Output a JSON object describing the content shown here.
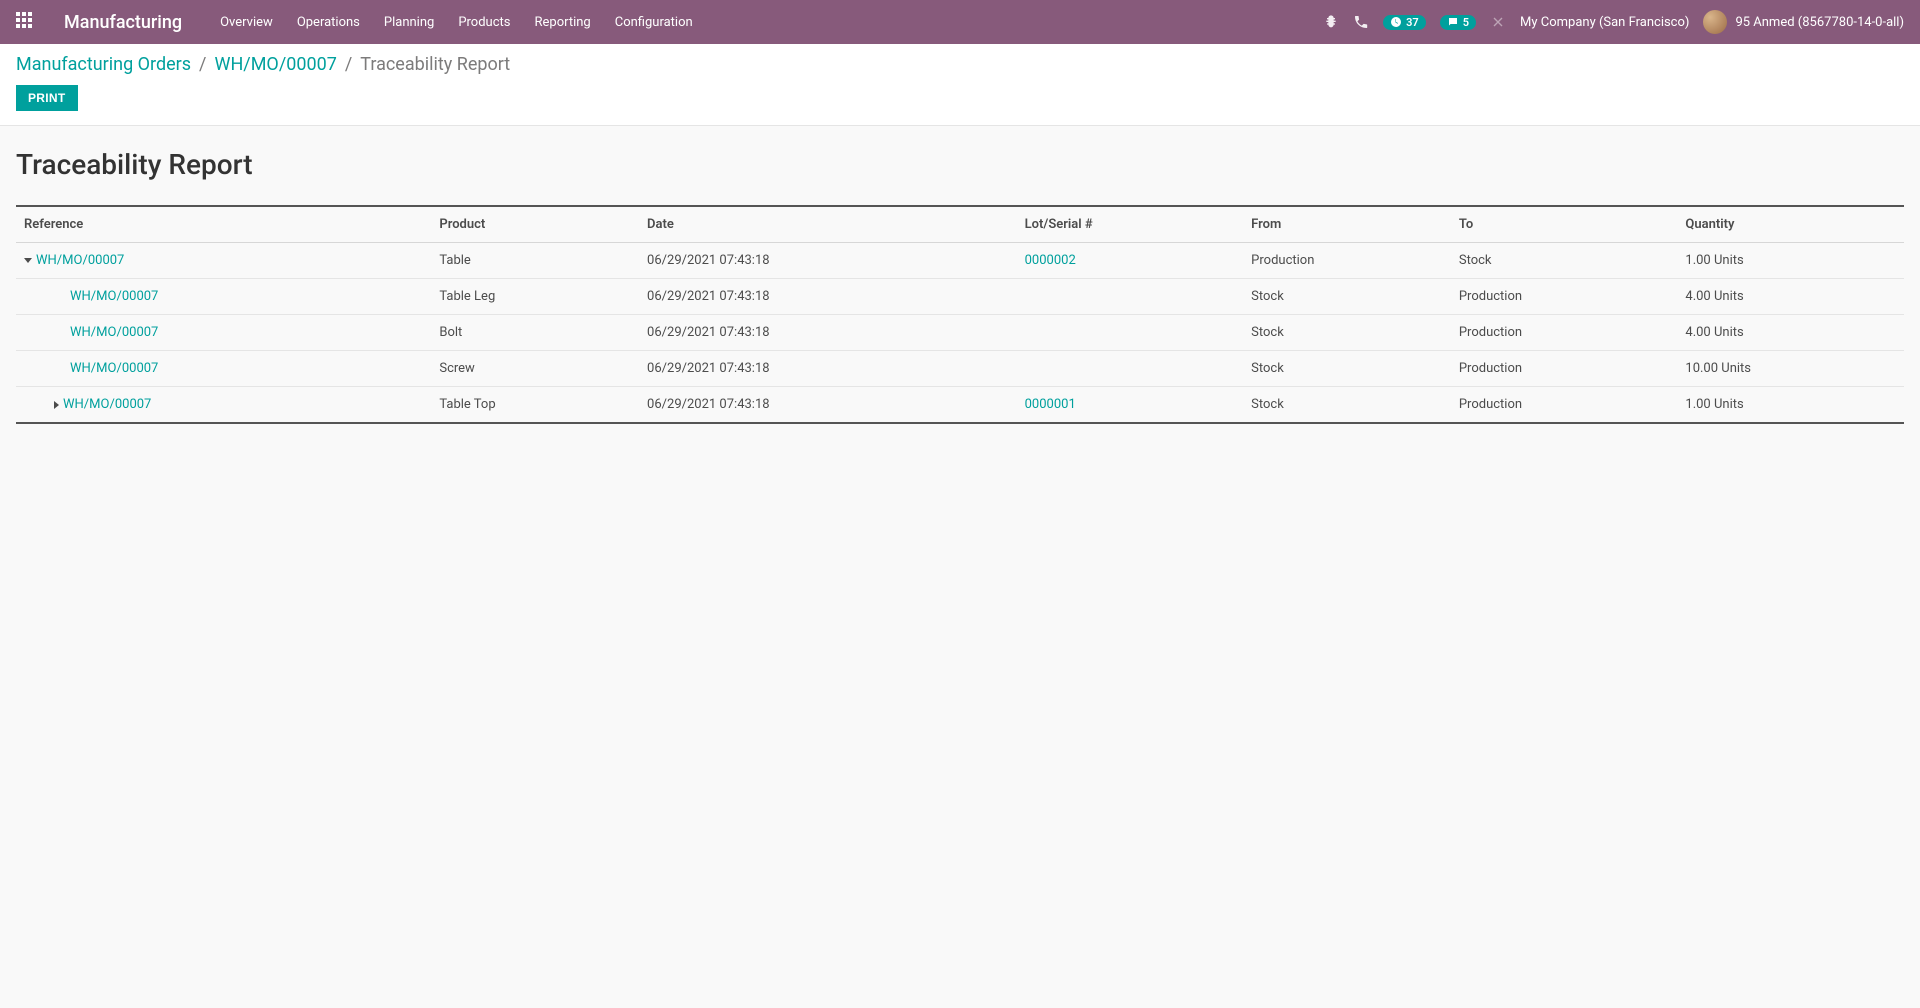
{
  "navbar": {
    "brand": "Manufacturing",
    "menu": [
      "Overview",
      "Operations",
      "Planning",
      "Products",
      "Reporting",
      "Configuration"
    ],
    "activities_badge": "37",
    "messages_badge": "5",
    "company": "My Company (San Francisco)",
    "user": "95 Anmed (8567780-14-0-all)"
  },
  "breadcrumbs": {
    "items": [
      "Manufacturing Orders",
      "WH/MO/00007"
    ],
    "current": "Traceability Report",
    "sep": "/"
  },
  "buttons": {
    "print": "Print"
  },
  "report": {
    "title": "Traceability Report",
    "headers": {
      "reference": "Reference",
      "product": "Product",
      "date": "Date",
      "lot": "Lot/Serial #",
      "from": "From",
      "to": "To",
      "quantity": "Quantity"
    },
    "rows": [
      {
        "indent": 0,
        "caret": "down",
        "reference": "WH/MO/00007",
        "product": "Table",
        "date": "06/29/2021 07:43:18",
        "lot": "0000002",
        "from": "Production",
        "to": "Stock",
        "quantity": "1.00 Units"
      },
      {
        "indent": 2,
        "caret": "",
        "reference": "WH/MO/00007",
        "product": "Table Leg",
        "date": "06/29/2021 07:43:18",
        "lot": "",
        "from": "Stock",
        "to": "Production",
        "quantity": "4.00 Units"
      },
      {
        "indent": 2,
        "caret": "",
        "reference": "WH/MO/00007",
        "product": "Bolt",
        "date": "06/29/2021 07:43:18",
        "lot": "",
        "from": "Stock",
        "to": "Production",
        "quantity": "4.00 Units"
      },
      {
        "indent": 2,
        "caret": "",
        "reference": "WH/MO/00007",
        "product": "Screw",
        "date": "06/29/2021 07:43:18",
        "lot": "",
        "from": "Stock",
        "to": "Production",
        "quantity": "10.00 Units"
      },
      {
        "indent": 1,
        "caret": "right",
        "reference": "WH/MO/00007",
        "product": "Table Top",
        "date": "06/29/2021 07:43:18",
        "lot": "0000001",
        "from": "Stock",
        "to": "Production",
        "quantity": "1.00 Units"
      }
    ]
  }
}
